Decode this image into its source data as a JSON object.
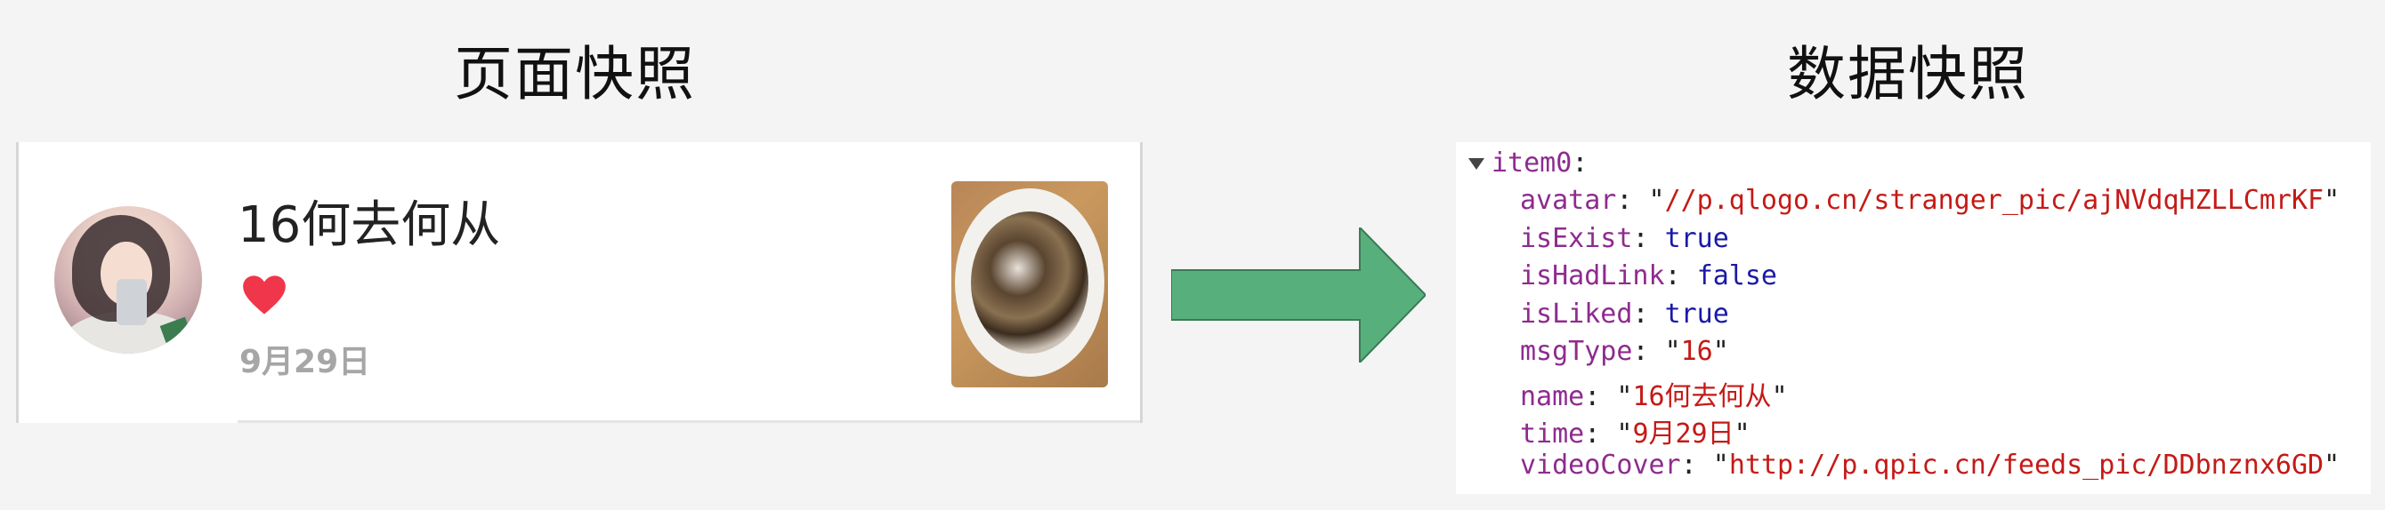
{
  "headings": {
    "left": "页面快照",
    "right": "数据快照"
  },
  "page_snapshot": {
    "name": "16何去何从",
    "date": "9月29日",
    "liked_icon": "heart-icon",
    "accent_color": "#f0364a"
  },
  "data_snapshot": {
    "object_key": "item0",
    "properties": [
      {
        "key": "avatar",
        "type": "string",
        "value": "//p.qlogo.cn/stranger_pic/ajNVdqHZLLCmrKF"
      },
      {
        "key": "isExist",
        "type": "bool",
        "value": "true"
      },
      {
        "key": "isHadLink",
        "type": "bool",
        "value": "false"
      },
      {
        "key": "isLiked",
        "type": "bool",
        "value": "true"
      },
      {
        "key": "msgType",
        "type": "string",
        "value": "16"
      },
      {
        "key": "name",
        "type": "string",
        "value": "16何去何从"
      },
      {
        "key": "time",
        "type": "string",
        "value": "9月29日"
      },
      {
        "key": "videoCover",
        "type": "string",
        "value": "http://p.qpic.cn/feeds_pic/DDbnznx6GD"
      }
    ],
    "colors": {
      "key": "#8e2b8e",
      "string": "#c41a16",
      "bool": "#1a1aa6"
    }
  },
  "arrow_color": "#57b07c"
}
